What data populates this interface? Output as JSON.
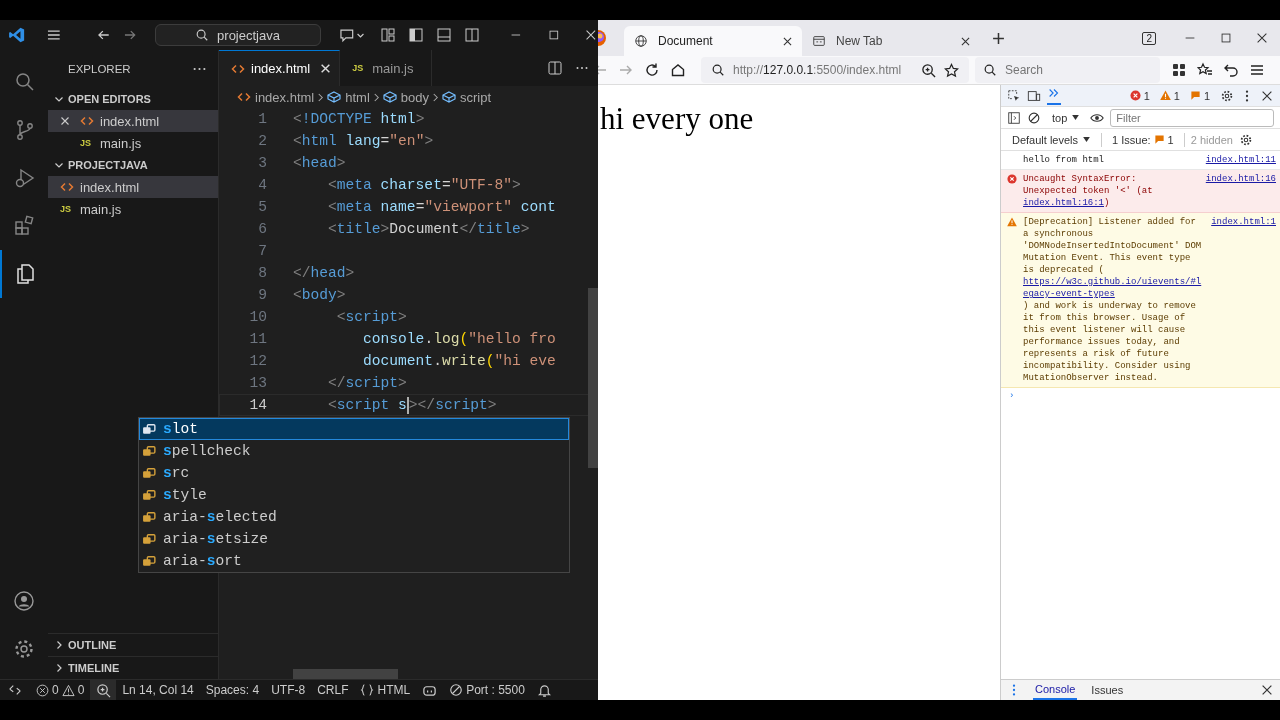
{
  "vscode": {
    "search": "projectjava",
    "activity_bar": [
      {
        "kind": "search",
        "selected": false
      },
      {
        "kind": "source-control",
        "selected": false
      },
      {
        "kind": "run",
        "selected": false
      },
      {
        "kind": "extensions",
        "selected": false
      },
      {
        "kind": "explorer",
        "selected": true
      }
    ],
    "sidebar": {
      "title": "EXPLORER",
      "sections": [
        {
          "label": "OPEN EDITORS",
          "expanded": true,
          "items": [
            {
              "name": "index.html",
              "kind": "html",
              "selected": true,
              "closable": true
            },
            {
              "name": "main.js",
              "kind": "js",
              "badge": "JS",
              "selected": false,
              "closable": false
            }
          ]
        },
        {
          "label": "PROJECTJAVA",
          "expanded": true,
          "items": [
            {
              "name": "index.html",
              "kind": "html",
              "selected": true,
              "closable": false
            },
            {
              "name": "main.js",
              "kind": "js",
              "badge": "JS",
              "selected": false,
              "closable": false
            }
          ]
        }
      ],
      "footer_sections": [
        {
          "label": "OUTLINE",
          "expanded": false
        },
        {
          "label": "TIMELINE",
          "expanded": false
        }
      ]
    },
    "tabs": [
      {
        "label": "index.html",
        "kind": "html",
        "selected": true
      },
      {
        "label": "main.js",
        "kind": "js",
        "badge": "JS",
        "selected": false
      }
    ],
    "breadcrumbs": [
      {
        "label": "index.html",
        "kind": "html"
      },
      {
        "label": "html",
        "kind": "element"
      },
      {
        "label": "body",
        "kind": "element"
      },
      {
        "label": "script",
        "kind": "element"
      }
    ],
    "code": [
      {
        "number": "1",
        "current": false,
        "tokens": [
          {
            "t": "<",
            "kind": "p"
          },
          {
            "t": "!DOCTYPE",
            "kind": "tag"
          },
          {
            "t": " html",
            "kind": "attr"
          },
          {
            "t": ">",
            "kind": "p"
          }
        ]
      },
      {
        "number": "2",
        "current": false,
        "tokens": [
          {
            "t": "<",
            "kind": "p"
          },
          {
            "t": "html",
            "kind": "tag"
          },
          {
            "t": " lang",
            "kind": "attr"
          },
          {
            "t": "=",
            "kind": "text"
          },
          {
            "t": "\"en\"",
            "kind": "str"
          },
          {
            "t": ">",
            "kind": "p"
          }
        ]
      },
      {
        "number": "3",
        "current": false,
        "tokens": [
          {
            "t": "<",
            "kind": "p"
          },
          {
            "t": "head",
            "kind": "tag"
          },
          {
            "t": ">",
            "kind": "p"
          }
        ]
      },
      {
        "number": "4",
        "current": false,
        "tokens": [
          {
            "t": "    <",
            "kind": "p"
          },
          {
            "t": "meta",
            "kind": "tag"
          },
          {
            "t": " charset",
            "kind": "attr"
          },
          {
            "t": "=",
            "kind": "text"
          },
          {
            "t": "\"UTF-8\"",
            "kind": "str"
          },
          {
            "t": ">",
            "kind": "p"
          }
        ]
      },
      {
        "number": "5",
        "current": false,
        "tokens": [
          {
            "t": "    <",
            "kind": "p"
          },
          {
            "t": "meta",
            "kind": "tag"
          },
          {
            "t": " name",
            "kind": "attr"
          },
          {
            "t": "=",
            "kind": "text"
          },
          {
            "t": "\"viewport\"",
            "kind": "str"
          },
          {
            "t": " cont",
            "kind": "attr"
          }
        ]
      },
      {
        "number": "6",
        "current": false,
        "tokens": [
          {
            "t": "    <",
            "kind": "p"
          },
          {
            "t": "title",
            "kind": "tag"
          },
          {
            "t": ">",
            "kind": "p"
          },
          {
            "t": "Document",
            "kind": "text"
          },
          {
            "t": "</",
            "kind": "p"
          },
          {
            "t": "title",
            "kind": "tag"
          },
          {
            "t": ">",
            "kind": "p"
          }
        ]
      },
      {
        "number": "7",
        "current": false
      },
      {
        "number": "8",
        "current": false,
        "tokens": [
          {
            "t": "</",
            "kind": "p"
          },
          {
            "t": "head",
            "kind": "tag"
          },
          {
            "t": ">",
            "kind": "p"
          }
        ]
      },
      {
        "number": "9",
        "current": false,
        "tokens": [
          {
            "t": "<",
            "kind": "p"
          },
          {
            "t": "body",
            "kind": "tag"
          },
          {
            "t": ">",
            "kind": "p"
          }
        ]
      },
      {
        "number": "10",
        "current": false,
        "tokens": [
          {
            "t": "     <",
            "kind": "p"
          },
          {
            "t": "script",
            "kind": "tag"
          },
          {
            "t": ">",
            "kind": "p"
          }
        ]
      },
      {
        "number": "11",
        "current": false,
        "tokens": [
          {
            "t": "        console",
            "kind": "var"
          },
          {
            "t": ".",
            "kind": "text"
          },
          {
            "t": "log",
            "kind": "fn"
          },
          {
            "t": "(",
            "kind": "paren"
          },
          {
            "t": "\"hello fro",
            "kind": "str"
          }
        ]
      },
      {
        "number": "12",
        "current": false,
        "tokens": [
          {
            "t": "        document",
            "kind": "var"
          },
          {
            "t": ".",
            "kind": "text"
          },
          {
            "t": "write",
            "kind": "fn"
          },
          {
            "t": "(",
            "kind": "paren"
          },
          {
            "t": "\"hi eve",
            "kind": "str"
          }
        ]
      },
      {
        "number": "13",
        "current": false,
        "tokens": [
          {
            "t": "    </",
            "kind": "p"
          },
          {
            "t": "script",
            "kind": "tag"
          },
          {
            "t": ">",
            "kind": "p"
          }
        ]
      },
      {
        "number": "14",
        "current": true,
        "tokens": [
          {
            "t": "    <",
            "kind": "p"
          },
          {
            "t": "script",
            "kind": "tag"
          },
          {
            "t": " s",
            "kind": "attr"
          },
          {
            "kind": "cursor"
          },
          {
            "t": "></",
            "kind": "p"
          },
          {
            "t": "script",
            "kind": "tag"
          },
          {
            "t": ">",
            "kind": "p"
          }
        ]
      }
    ],
    "suggestions": [
      {
        "match": "s",
        "after": "lot",
        "selected": true
      },
      {
        "match": "s",
        "after": "pellcheck",
        "selected": false
      },
      {
        "match": "s",
        "after": "rc",
        "selected": false
      },
      {
        "match": "s",
        "after": "tyle",
        "selected": false
      },
      {
        "before": "aria-",
        "match": "s",
        "after": "elected",
        "selected": false
      },
      {
        "before": "aria-",
        "match": "s",
        "after": "etsize",
        "selected": false
      },
      {
        "before": "aria-",
        "match": "s",
        "after": "ort",
        "selected": false
      }
    ],
    "status_bar": {
      "errors": "0",
      "warnings": "0",
      "position": "Ln 14, Col 14",
      "indent": "Spaces: 4",
      "encoding": "UTF-8",
      "eol": "CRLF",
      "language": "HTML",
      "port": "Port : 5500"
    }
  },
  "browser": {
    "tabs": [
      {
        "title": "Document",
        "kind": "page",
        "selected": true
      },
      {
        "title": "New Tab",
        "kind": "newtab",
        "selected": false
      }
    ],
    "window_count": "2",
    "url": {
      "scheme": "http://",
      "host": "127.0.0.1",
      "path": ":5500/index.html"
    },
    "search": {
      "placeholder": "Search"
    },
    "page_text": "hi every one",
    "devtools": {
      "error_count": "1",
      "warning_count": "1",
      "issue_count": "1",
      "context": "top",
      "filter": {
        "placeholder": "Filter"
      },
      "levels": "Default levels",
      "issues_label": "1 Issue:",
      "issues_count": "1",
      "hidden": "2 hidden",
      "messages": [
        {
          "kind": "log",
          "text": "hello from html",
          "source": "index.html:11"
        },
        {
          "kind": "error",
          "text": "Uncaught SyntaxError:\nUnexpected token '<' (at ",
          "link": "index.html:16:1",
          "text_after": ")",
          "source": "index.html:16"
        },
        {
          "kind": "warning",
          "text": "[Deprecation] Listener added for a synchronous 'DOMNodeInsertedIntoDocument' DOM Mutation Event. This event type is deprecated (",
          "link": "https://w3c.github.io/uievents/#legacy-event-types",
          "text_after": ") and work is underway to remove it from this browser. Usage of this event listener will cause performance issues today, and represents a risk of future incompatibility. Consider using MutationObserver instead.",
          "source": "index.html:1"
        }
      ],
      "prompt": "›",
      "drawer_tabs": [
        {
          "label": "Console",
          "selected": true
        },
        {
          "label": "Issues",
          "selected": false
        }
      ]
    }
  }
}
